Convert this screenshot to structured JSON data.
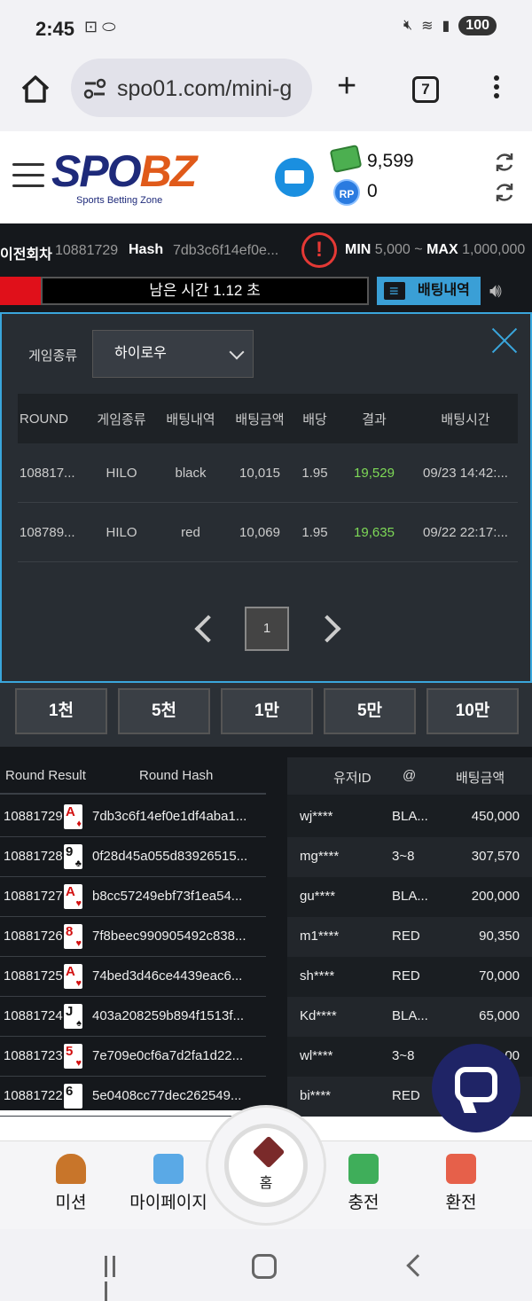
{
  "status_bar": {
    "time": "2:45",
    "battery": "100"
  },
  "browser": {
    "url": "spo01.com/mini-g",
    "tab_count": "7"
  },
  "site": {
    "logo_spo": "SPO",
    "logo_bz": "BZ",
    "logo_sub": "Sports Betting Zone",
    "money": "9,599",
    "rp_label": "RP",
    "rp": "0"
  },
  "info_bar": {
    "prev_round_label": "이전회차",
    "prev_round": "10881729",
    "hash_label": "Hash",
    "hash": "7db3c6f14ef0e...",
    "min_label": "MIN",
    "min_val": "5,000",
    "tilde": "~",
    "max_label": "MAX",
    "max_val": "1,000,000"
  },
  "timer": {
    "text": "남은 시간 1.12 초"
  },
  "history_button": "배팅내역",
  "panel": {
    "type_label": "게임종류",
    "type_value": "하이로우",
    "headers": [
      "ROUND",
      "게임종류",
      "배팅내역",
      "배팅금액",
      "배당",
      "결과",
      "배팅시간"
    ],
    "rows": [
      [
        "108817...",
        "HILO",
        "black",
        "10,015",
        "1.95",
        "19,529",
        "09/23 14:42:..."
      ],
      [
        "108789...",
        "HILO",
        "red",
        "10,069",
        "1.95",
        "19,635",
        "09/22 22:17:..."
      ]
    ],
    "page": "1"
  },
  "chips": [
    "1천",
    "5천",
    "1만",
    "5만",
    "10만"
  ],
  "round_results": {
    "headers": [
      "Round Result",
      "Round Hash"
    ],
    "rows": [
      {
        "round": "10881729",
        "card": "A",
        "suit": "♦",
        "red": true,
        "hash": "7db3c6f14ef0e1df4aba1..."
      },
      {
        "round": "10881728",
        "card": "9",
        "suit": "♣",
        "red": false,
        "hash": "0f28d45a055d83926515..."
      },
      {
        "round": "10881727",
        "card": "A",
        "suit": "♥",
        "red": true,
        "hash": "b8cc57249ebf73f1ea54..."
      },
      {
        "round": "10881726",
        "card": "8",
        "suit": "♥",
        "red": true,
        "hash": "7f8beec990905492c838..."
      },
      {
        "round": "10881725",
        "card": "A",
        "suit": "♥",
        "red": true,
        "hash": "74bed3d46ce4439eac6..."
      },
      {
        "round": "10881724",
        "card": "J",
        "suit": "♠",
        "red": false,
        "hash": "403a208259b894f1513f..."
      },
      {
        "round": "10881723",
        "card": "5",
        "suit": "♥",
        "red": true,
        "hash": "7e709e0cf6a7d2fa1d22..."
      },
      {
        "round": "10881722",
        "card": "6",
        "suit": "",
        "red": false,
        "hash": "5e0408cc77dec262549..."
      }
    ]
  },
  "user_bets": {
    "headers": [
      "유저ID",
      "@",
      "배팅금액"
    ],
    "rows": [
      {
        "user": "wj****",
        "at": "BLA...",
        "amount": "450,000"
      },
      {
        "user": "mg****",
        "at": "3~8",
        "amount": "307,570"
      },
      {
        "user": "gu****",
        "at": "BLA...",
        "amount": "200,000"
      },
      {
        "user": "m1****",
        "at": "RED",
        "amount": "90,350"
      },
      {
        "user": "sh****",
        "at": "RED",
        "amount": "70,000"
      },
      {
        "user": "Kd****",
        "at": "BLA...",
        "amount": "65,000"
      },
      {
        "user": "wl****",
        "at": "3~8",
        "amount": "...00"
      },
      {
        "user": "bi****",
        "at": "RED",
        "amount": ""
      }
    ]
  },
  "bottom_nav": {
    "mission": "미션",
    "mypage": "마이페이지",
    "home": "홈",
    "charge": "충전",
    "exchange": "환전"
  }
}
